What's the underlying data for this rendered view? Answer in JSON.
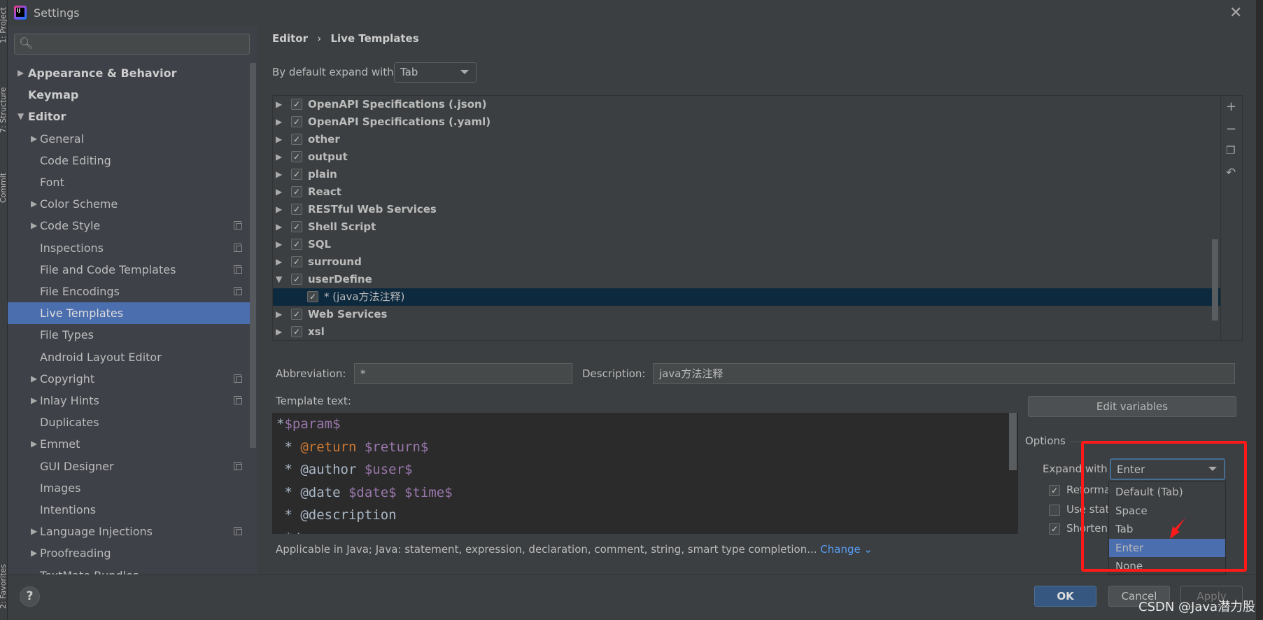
{
  "window": {
    "title": "Settings",
    "close_icon": "close-icon"
  },
  "toolstrip": [
    "1: Project",
    "7: Structure",
    "Commit",
    "2: Favorites"
  ],
  "sidebar": {
    "search_placeholder": "",
    "items": [
      {
        "label": "Appearance & Behavior",
        "level": 0,
        "arrow": "right",
        "bold": true
      },
      {
        "label": "Keymap",
        "level": 0,
        "bold": true
      },
      {
        "label": "Editor",
        "level": 0,
        "arrow": "down",
        "bold": true
      },
      {
        "label": "General",
        "level": 1,
        "arrow": "right"
      },
      {
        "label": "Code Editing",
        "level": 1
      },
      {
        "label": "Font",
        "level": 1
      },
      {
        "label": "Color Scheme",
        "level": 1,
        "arrow": "right"
      },
      {
        "label": "Code Style",
        "level": 1,
        "arrow": "right",
        "copy": true
      },
      {
        "label": "Inspections",
        "level": 1,
        "copy": true
      },
      {
        "label": "File and Code Templates",
        "level": 1,
        "copy": true
      },
      {
        "label": "File Encodings",
        "level": 1,
        "copy": true
      },
      {
        "label": "Live Templates",
        "level": 1,
        "selected": true
      },
      {
        "label": "File Types",
        "level": 1
      },
      {
        "label": "Android Layout Editor",
        "level": 1
      },
      {
        "label": "Copyright",
        "level": 1,
        "arrow": "right",
        "copy": true
      },
      {
        "label": "Inlay Hints",
        "level": 1,
        "arrow": "right",
        "copy": true
      },
      {
        "label": "Duplicates",
        "level": 1
      },
      {
        "label": "Emmet",
        "level": 1,
        "arrow": "right"
      },
      {
        "label": "GUI Designer",
        "level": 1,
        "copy": true
      },
      {
        "label": "Images",
        "level": 1
      },
      {
        "label": "Intentions",
        "level": 1
      },
      {
        "label": "Language Injections",
        "level": 1,
        "arrow": "right",
        "copy": true
      },
      {
        "label": "Proofreading",
        "level": 1,
        "arrow": "right"
      },
      {
        "label": "TextMate Bundles",
        "level": 1
      }
    ]
  },
  "main": {
    "breadcrumb": [
      "Editor",
      "Live Templates"
    ],
    "default_expand_label": "By default expand with",
    "default_expand_value": "Tab",
    "template_groups": [
      {
        "label": "OpenAPI Specifications (.json)",
        "checked": true
      },
      {
        "label": "OpenAPI Specifications (.yaml)",
        "checked": true
      },
      {
        "label": "other",
        "checked": true
      },
      {
        "label": "output",
        "checked": true
      },
      {
        "label": "plain",
        "checked": true
      },
      {
        "label": "React",
        "checked": true
      },
      {
        "label": "RESTful Web Services",
        "checked": true
      },
      {
        "label": "Shell Script",
        "checked": true
      },
      {
        "label": "SQL",
        "checked": true
      },
      {
        "label": "surround",
        "checked": true
      },
      {
        "label": "userDefine",
        "checked": true,
        "expanded": true
      },
      {
        "label": "* (java方法注释)",
        "checked": true,
        "child": true,
        "selected": true
      },
      {
        "label": "Web Services",
        "checked": true
      },
      {
        "label": "xsl",
        "checked": true
      }
    ],
    "list_tools": [
      "plus-icon",
      "minus-icon",
      "copy-icon",
      "revert-icon"
    ],
    "abbreviation_label": "Abbreviation:",
    "abbreviation_value": "*",
    "description_label": "Description:",
    "description_value": "java方法注释",
    "template_text_label": "Template text:",
    "template_lines": [
      [
        {
          "t": "*",
          "c": ""
        },
        {
          "t": "$param$",
          "c": "v"
        }
      ],
      [
        {
          "t": " * ",
          "c": ""
        },
        {
          "t": "@return",
          "c": "k"
        },
        {
          "t": " ",
          "c": ""
        },
        {
          "t": "$return$",
          "c": "v"
        }
      ],
      [
        {
          "t": " * @author ",
          "c": ""
        },
        {
          "t": "$user$",
          "c": "v"
        }
      ],
      [
        {
          "t": " * @date ",
          "c": ""
        },
        {
          "t": "$date$",
          "c": "v"
        },
        {
          "t": " ",
          "c": ""
        },
        {
          "t": "$time$",
          "c": "v"
        }
      ],
      [
        {
          "t": " * @description",
          "c": ""
        }
      ],
      [
        {
          "t": " */",
          "c": ""
        }
      ]
    ],
    "applicable_text": "Applicable in Java; Java: statement, expression, declaration, comment, string, smart type completion...",
    "change_link": "Change",
    "edit_variables": "Edit variables",
    "options_label": "Options",
    "expand_with_label": "Expand with",
    "expand_with_value": "Enter",
    "checkboxes": [
      {
        "label": "Reforma",
        "checked": true
      },
      {
        "label": "Use stat",
        "checked": false
      },
      {
        "label": "Shorten",
        "checked": true
      }
    ],
    "expand_options": [
      "Default (Tab)",
      "Space",
      "Tab",
      "Enter",
      "None"
    ],
    "expand_selected_index": 3
  },
  "footer": {
    "help": "?",
    "ok": "OK",
    "cancel": "Cancel",
    "apply": "Apply"
  },
  "watermark": "CSDN @Java潜力股",
  "colors": {
    "accent": "#4b6eaf",
    "annotation": "#ff1a1a",
    "link": "#589df6",
    "variable": "#9876aa",
    "keyword": "#cc7832"
  }
}
